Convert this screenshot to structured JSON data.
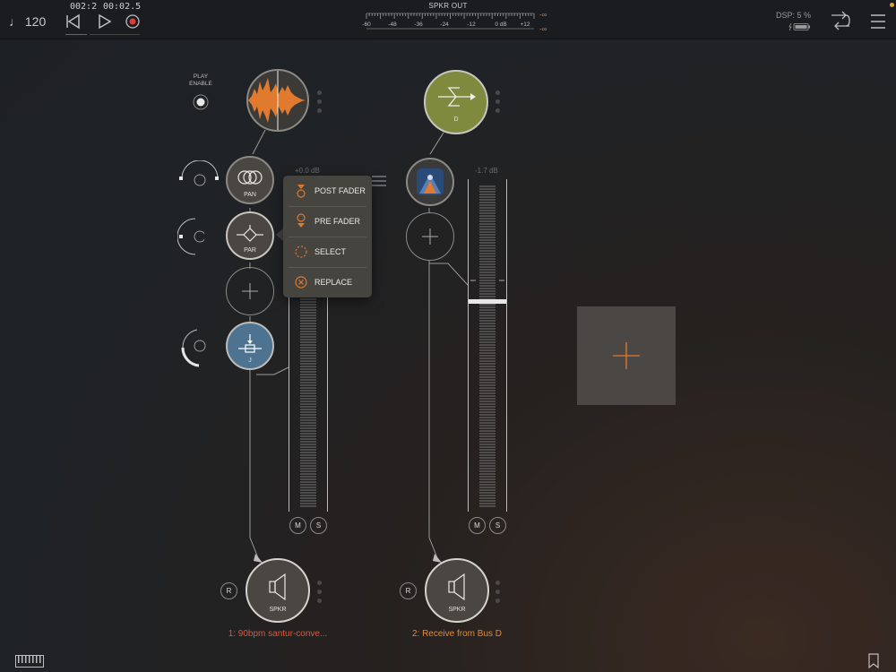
{
  "header": {
    "tempo": "♩ 120",
    "bar_position": "002:2",
    "time_position": "00:02.5",
    "meter_title": "SPKR OUT",
    "meter_scale": [
      "-60",
      "-48",
      "-36",
      "-24",
      "-12",
      "0 dB",
      "+12"
    ],
    "meter_inf_top": "-∞",
    "meter_inf_bottom": "-∞",
    "dsp_label": "DSP: 5 %"
  },
  "play_enable": {
    "line1": "PLAY",
    "line2": "ENABLE"
  },
  "channel1": {
    "pan_label": "PAN",
    "par_label": "PAR",
    "eq_label": "J",
    "db": "+0.0 dB",
    "mute": "M",
    "solo": "S",
    "record": "R",
    "output_label": "SPKR",
    "name": "1: 90bpm santur-conve..."
  },
  "channel2": {
    "bus_label": "D",
    "db": "-1.7 dB",
    "mute": "M",
    "solo": "S",
    "record": "R",
    "output_label": "SPKR",
    "name": "2: Receive from Bus D"
  },
  "context_menu": {
    "items": [
      {
        "label": "POST FADER",
        "icon": "post-fader-icon"
      },
      {
        "label": "PRE FADER",
        "icon": "pre-fader-icon"
      },
      {
        "label": "SELECT",
        "icon": "select-dashed-circle-icon"
      },
      {
        "label": "REPLACE",
        "icon": "replace-x-circle-icon"
      }
    ]
  },
  "colors": {
    "accent_orange": "#e07a2e",
    "record_red": "#e03b3b",
    "bus_green": "#7f8a3e",
    "eq_blue": "#4d7390",
    "channel1_name": "#d95a3e",
    "channel2_name": "#e08a35"
  }
}
